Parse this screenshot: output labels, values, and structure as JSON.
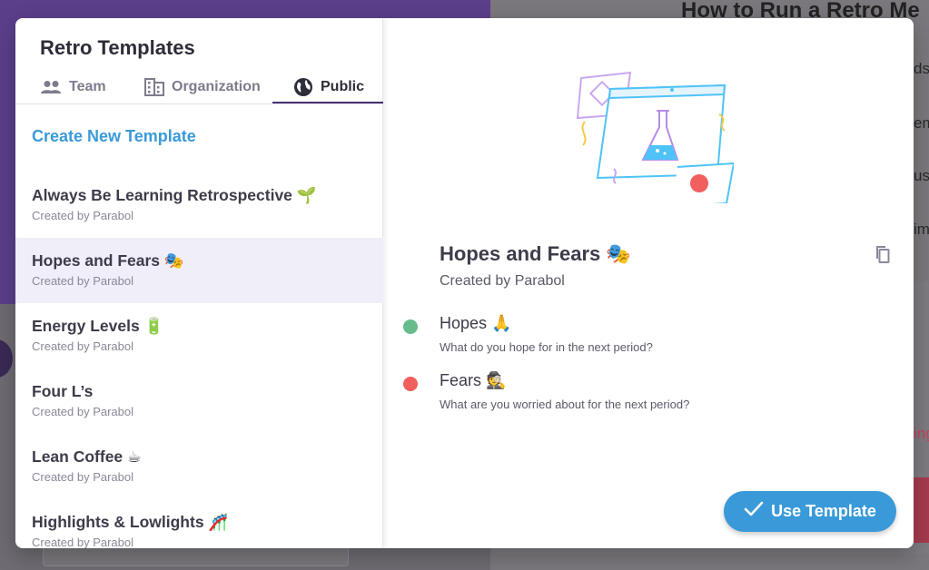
{
  "background": {
    "title": "How to Run a Retro Me",
    "fragments": [
      "ds",
      "em",
      "uss",
      "im",
      "ing"
    ]
  },
  "modal": {
    "title": "Retro Templates",
    "tabs": [
      {
        "label": "Team",
        "icon": "team-icon"
      },
      {
        "label": "Organization",
        "icon": "organization-icon"
      },
      {
        "label": "Public",
        "icon": "globe-icon",
        "active": true
      }
    ],
    "create_new": "Create New Template",
    "templates": [
      {
        "name": "Always Be Learning Retrospective 🌱",
        "author": "Created by Parabol"
      },
      {
        "name": "Hopes and Fears 🎭",
        "author": "Created by Parabol",
        "selected": true
      },
      {
        "name": "Energy Levels 🔋",
        "author": "Created by Parabol"
      },
      {
        "name": "Four L’s",
        "author": "Created by Parabol"
      },
      {
        "name": "Lean Coffee ☕",
        "author": "Created by Parabol"
      },
      {
        "name": "Highlights & Lowlights 🎢",
        "author": "Created by Parabol"
      }
    ]
  },
  "detail": {
    "title": "Hopes and Fears 🎭",
    "author": "Created by Parabol",
    "prompts": [
      {
        "question": "Hopes 🙏",
        "description": "What do you hope for in the next period?",
        "color": "#66bc8b"
      },
      {
        "question": "Fears 🕵",
        "description": "What are you worried about for the next period?",
        "color": "#f15f5f"
      }
    ],
    "use_button": "Use Template",
    "copy_icon": "copy-icon",
    "check_icon": "check-icon"
  },
  "colors": {
    "accent": "#3a9ad9",
    "primary": "#493272",
    "selected_bg": "#f0eef8"
  }
}
